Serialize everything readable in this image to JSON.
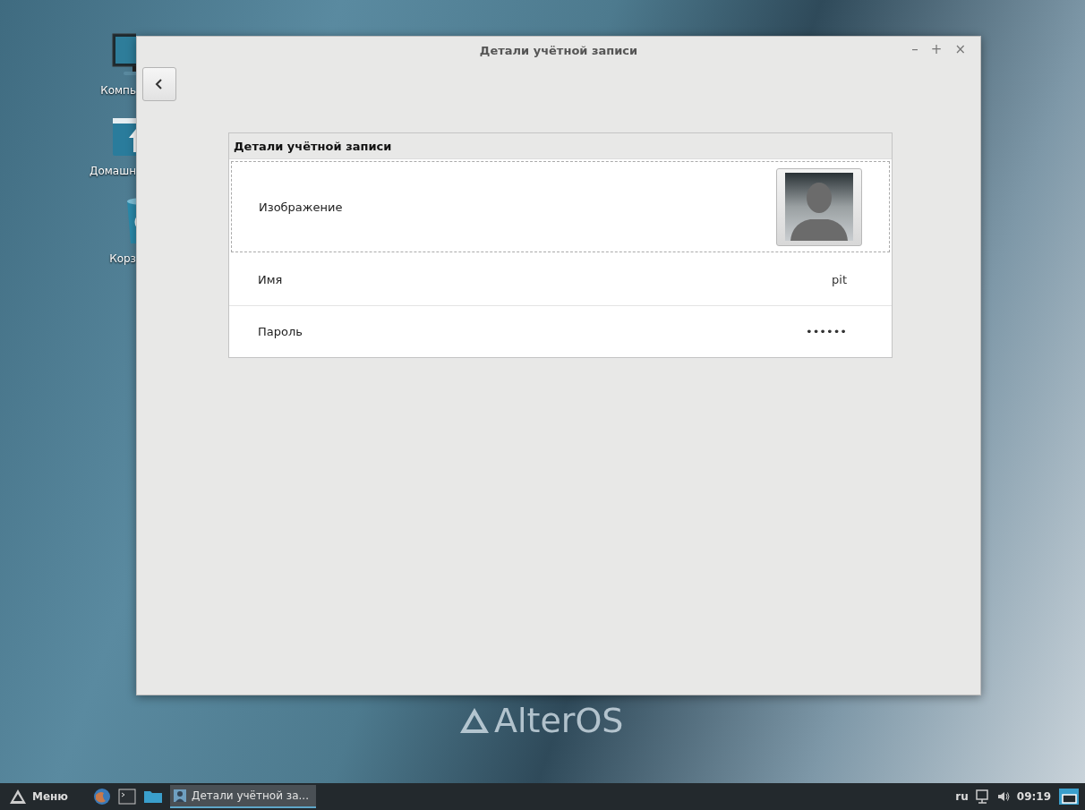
{
  "desktop": {
    "icons": [
      {
        "kind": "monitor",
        "label": "Компь"
      },
      {
        "kind": "home",
        "label": "Домашн"
      },
      {
        "kind": "trash",
        "label": "Корз"
      }
    ],
    "wallpaper_logo": "AlterOS"
  },
  "window": {
    "title": "Детали учётной записи",
    "controls": [
      "–",
      "+",
      "×"
    ],
    "card": {
      "title": "Детали учётной записи",
      "rows": [
        {
          "kind": "avatar",
          "label": "Изображение",
          "focused": true
        },
        {
          "kind": "text",
          "label": "Имя",
          "value": "pit"
        },
        {
          "kind": "text",
          "label": "Пароль",
          "value": "••••••"
        }
      ]
    }
  },
  "taskbar": {
    "menu_label": "Меню",
    "launchers": [
      {
        "kind": "browser"
      },
      {
        "kind": "terminal"
      },
      {
        "kind": "folder"
      }
    ],
    "tasks": [
      {
        "label": "Детали учётной за...",
        "selected": true
      }
    ],
    "keyboard_layout": "ru",
    "clock": "09:19"
  }
}
